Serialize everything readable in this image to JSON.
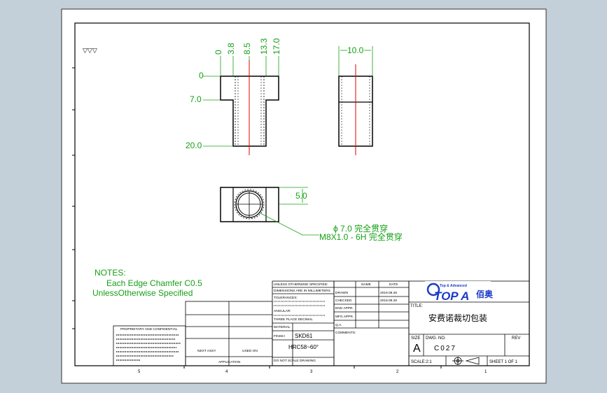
{
  "drawing": {
    "dims_top": [
      "0",
      "3.8",
      "8.5",
      "13.3",
      "17.0"
    ],
    "dims_left": [
      "0",
      "7.0",
      "20.0"
    ],
    "side_width": "10.0",
    "slot_dim": "5.0",
    "hole_callout_1": "ϕ 7.0 完全贯穿",
    "hole_callout_2": "M8X1.0 - 6H 完全贯穿",
    "surface_symbol": "▽▽▽"
  },
  "notes": {
    "title": "NOTES:",
    "line1": "Each Edge Chamfer C0.5",
    "line2": "UnlessOtherwise Specified"
  },
  "title_block": {
    "unless": "UNLESS OTHERWISE SPECIFIED:",
    "dims_in": "DIMENSIONS ARE IN MILLIMETERS",
    "tolerances": "TOLERANCES:",
    "angular": "ANGULAR:",
    "three_place": "THREE PLACE DECIMAL",
    "material_label": "MATERIAL",
    "material_value": "SKD61",
    "finish_label": "FINISH",
    "finish_value": "HRC58~60°",
    "drawn": "DRAWN",
    "checked": "CHECKED",
    "eng_appr": "ENG APPR.",
    "mfg_appr": "MFG APPR.",
    "qa": "Q.A.",
    "comments": "COMMENTS:",
    "name_header": "NAME",
    "date_header": "DATE",
    "drawn_date": "2019.09.26",
    "checked_date": "2019.09.26",
    "proprietary": "PROPRIETARY AND CONFIDENTIAL",
    "next_assy": "NEXT ASSY",
    "used_on": "USED ON",
    "application": "APPLICATION",
    "do_not_scale": "DO NOT SCALE DRAWING",
    "logo_text": "TOP A",
    "logo_cn": "佰奥",
    "logo_tag": "Top & Advanced",
    "title_label": "TITLE:",
    "title_value": "安费诺裁切包装",
    "size_label": "SIZE",
    "size_value": "A",
    "dwg_label": "DWG. NO.",
    "dwg_value": "C027",
    "rev_label": "REV",
    "scale": "SCALE:2:1",
    "sheet": "SHEET 1 OF 1"
  },
  "zones_bottom": [
    "5",
    "4",
    "3",
    "2",
    "1"
  ]
}
